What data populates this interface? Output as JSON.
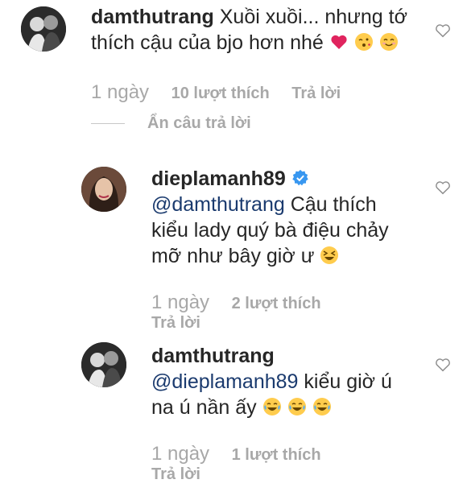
{
  "comments": [
    {
      "username": "damthutrang",
      "text": "Xuồi xuồi... nhưng tớ thích cậu của bjo hơn nhé",
      "time": "1 ngày",
      "likes": "10 lượt thích",
      "reply": "Trả lời",
      "hide_replies": "Ẩn câu trả lời",
      "emojis": [
        "heart-emoji",
        "kissing-face-emoji",
        "smiling-face-emoji"
      ]
    },
    {
      "username": "dieplamanh89",
      "verified": true,
      "mention": "@damthutrang",
      "text": "Cậu thích kiểu lady quý bà điệu chảy mỡ như bây giờ ư",
      "time": "1 ngày",
      "likes": "2 lượt thích",
      "reply": "Trả lời",
      "emojis": [
        "grinning-squinting-face-emoji"
      ]
    },
    {
      "username": "damthutrang",
      "mention": "@dieplamanh89",
      "text": "kiểu giờ ú na ú nần ấy",
      "time": "1 ngày",
      "likes": "1 lượt thích",
      "reply": "Trả lời",
      "emojis": [
        "tears-of-joy-emoji",
        "tears-of-joy-emoji",
        "tears-of-joy-emoji"
      ]
    }
  ],
  "colors": {
    "text": "#262626",
    "meta": "#a8a8a8",
    "mention": "#1a3a6e",
    "verified": "#3897f0",
    "heart_emoji": "#e0245e",
    "emoji_yellow": "#ffcc4d"
  }
}
